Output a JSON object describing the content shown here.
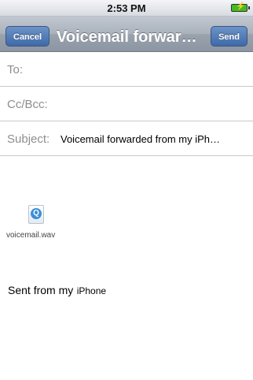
{
  "status_bar": {
    "time": "2:53 PM",
    "battery_icon": "battery-charging-icon"
  },
  "nav": {
    "cancel_label": "Cancel",
    "title": "Voicemail forwar…",
    "send_label": "Send"
  },
  "fields": {
    "to_label": "To:",
    "ccbcc_label": "Cc/Bcc:",
    "subject_label": "Subject:",
    "subject_value": "Voicemail forwarded from my iPh…"
  },
  "attachment": {
    "icon": "quicktime-file-icon",
    "glyph": "Q",
    "filename": "voicemail.wav"
  },
  "body": {
    "signature_main": "Sent from my",
    "signature_device": "iPhone"
  }
}
